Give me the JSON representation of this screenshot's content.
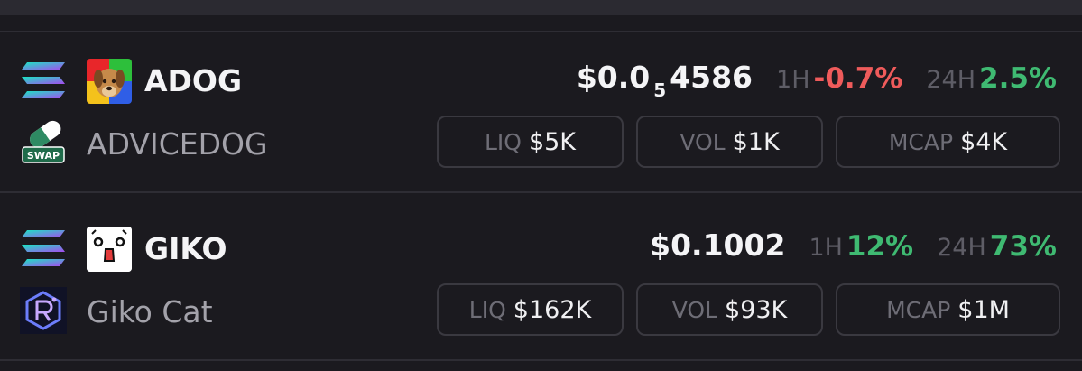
{
  "tokens": [
    {
      "symbol": "ADOG",
      "name": "ADVICEDOG",
      "token_icon": "dog-face-icon",
      "chain_icon": "solana-icon",
      "dex_icon": "swap-pill-icon",
      "dex_label": "SWAP",
      "price_main": "$0.0",
      "price_sub": "5",
      "price_tail": "4586",
      "tf1": "1H",
      "change_1h": "-0.7%",
      "tf2": "24H",
      "change_24h": "2.5%",
      "liq_label": "LIQ",
      "liq_value": "$5K",
      "vol_label": "VOL",
      "vol_value": "$1K",
      "mcap_label": "MCAP",
      "mcap_value": "$4K"
    },
    {
      "symbol": "GIKO",
      "name": "Giko Cat",
      "token_icon": "giko-cat-face-icon",
      "chain_icon": "solana-icon",
      "dex_icon": "raydium-icon",
      "price_main": "$0.1002",
      "tf1": "1H",
      "change_1h": "12%",
      "tf2": "24H",
      "change_24h": "73%",
      "liq_label": "LIQ",
      "liq_value": "$162K",
      "vol_label": "VOL",
      "vol_value": "$93K",
      "mcap_label": "MCAP",
      "mcap_value": "$1M"
    }
  ],
  "colors": {
    "background": "#1b1a1f",
    "negative": "#ef5b5b",
    "positive": "#3fba72",
    "stat_border": "#3a3940"
  }
}
